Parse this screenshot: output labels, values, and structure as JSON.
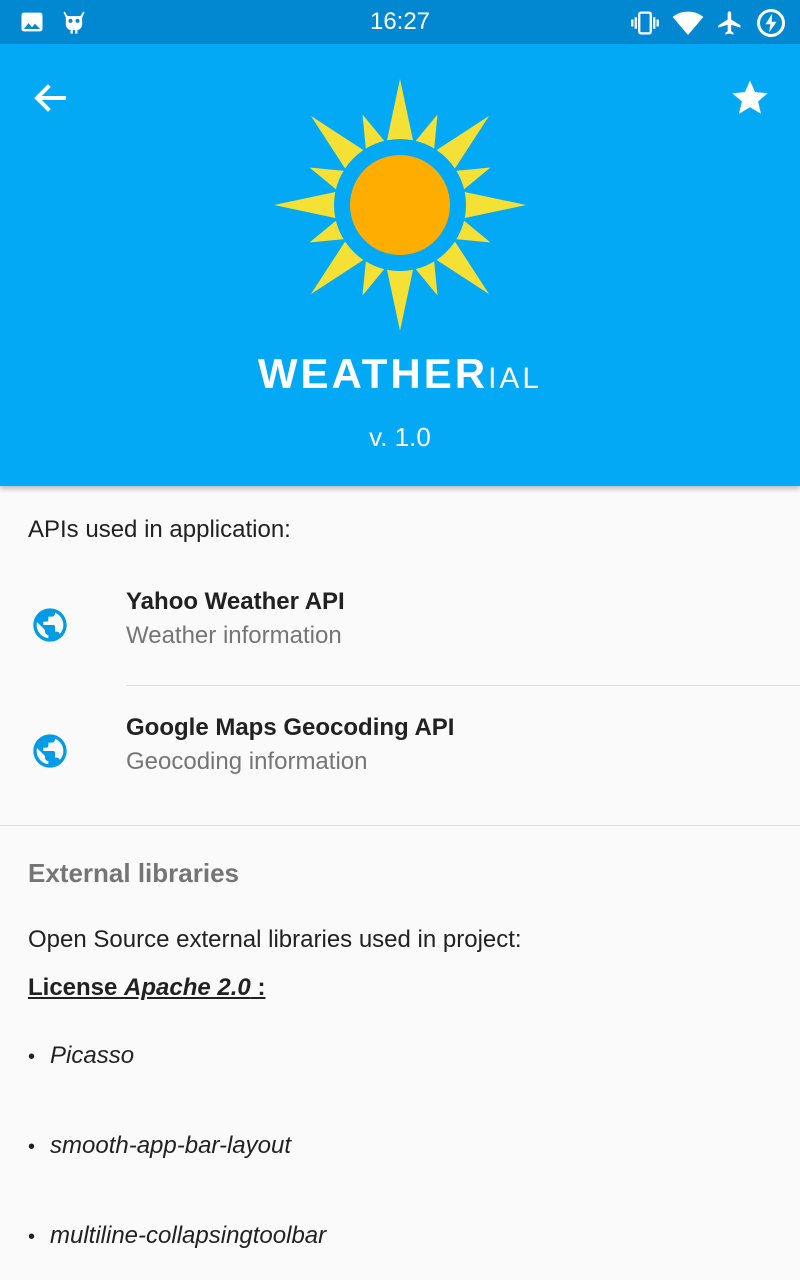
{
  "status_bar": {
    "time": "16:27",
    "left_icons": [
      "image-icon",
      "android-debug-icon"
    ],
    "right_icons": [
      "vibrate-icon",
      "wifi-icon",
      "airplane-mode-icon",
      "battery-charging-icon"
    ]
  },
  "header": {
    "back_icon": "arrow-back-icon",
    "favorite_icon": "star-icon",
    "logo_icon": "sun-icon",
    "brand_main": "WEATHER",
    "brand_suffix": "IAL",
    "version": "v. 1.0",
    "colors": {
      "app_bar": "#03a9f4",
      "status_bar": "#0288d1",
      "sun_rays": "#f5e136",
      "sun_core": "#ffae00"
    }
  },
  "apis": {
    "intro": "APIs used in application:",
    "items": [
      {
        "title": "Yahoo Weather API",
        "subtitle": "Weather information",
        "icon": "globe-icon"
      },
      {
        "title": "Google Maps Geocoding API",
        "subtitle": "Geocoding information",
        "icon": "globe-icon"
      }
    ]
  },
  "external": {
    "title": "External libraries",
    "description": "Open Source external libraries used in project:",
    "license_prefix": "License ",
    "license_name": "Apache 2.0",
    "license_suffix": " :",
    "libraries": [
      "Picasso",
      "smooth-app-bar-layout",
      "multiline-collapsingtoolbar"
    ],
    "bullet": "•"
  }
}
